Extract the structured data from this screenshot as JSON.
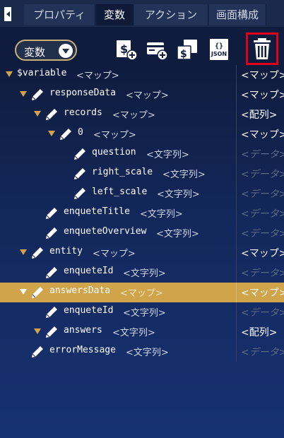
{
  "tabs": [
    {
      "label": "プロパティ",
      "active": false
    },
    {
      "label": "変数",
      "active": true
    },
    {
      "label": "アクション",
      "active": false
    },
    {
      "label": "画面構成",
      "active": false
    }
  ],
  "toolbar": {
    "dropdown_label": "変数",
    "icons": [
      "add-variable-icon",
      "add-card-icon",
      "copy-variable-icon",
      "json-icon",
      "trash-icon"
    ],
    "json_label": "JSON"
  },
  "colors": {
    "accent": "#cfa44a",
    "highlight_border": "#e0001a",
    "background": "#0f1c3e"
  },
  "tree": [
    {
      "name": "$variable",
      "type": "<マップ>",
      "value": "<マップ>",
      "depth": 0,
      "toggle": true,
      "edit": false,
      "placeholder": false,
      "selected": false
    },
    {
      "name": "responseData",
      "type": "<マップ>",
      "value": "<マップ>",
      "depth": 1,
      "toggle": true,
      "edit": true,
      "placeholder": false,
      "selected": false
    },
    {
      "name": "records",
      "type": "<マップ>",
      "value": "<配列>",
      "depth": 2,
      "toggle": true,
      "edit": true,
      "placeholder": false,
      "selected": false
    },
    {
      "name": "0",
      "type": "<マップ>",
      "value": "<マップ>",
      "depth": 3,
      "toggle": true,
      "edit": true,
      "placeholder": false,
      "selected": false
    },
    {
      "name": "question",
      "type": "<文字列>",
      "value": "<データ>",
      "depth": 4,
      "toggle": false,
      "edit": true,
      "placeholder": true,
      "selected": false
    },
    {
      "name": "right_scale",
      "type": "<文字列>",
      "value": "<データ>",
      "depth": 4,
      "toggle": false,
      "edit": true,
      "placeholder": true,
      "selected": false
    },
    {
      "name": "left_scale",
      "type": "<文字列>",
      "value": "<データ>",
      "depth": 4,
      "toggle": false,
      "edit": true,
      "placeholder": true,
      "selected": false
    },
    {
      "name": "enqueteTitle",
      "type": "<文字列>",
      "value": "<データ>",
      "depth": 2,
      "toggle": false,
      "edit": true,
      "placeholder": true,
      "selected": false
    },
    {
      "name": "enqueteOverview",
      "type": "<文字列>",
      "value": "<データ>",
      "depth": 2,
      "toggle": false,
      "edit": true,
      "placeholder": true,
      "selected": false
    },
    {
      "name": "entity",
      "type": "<マップ>",
      "value": "<マップ>",
      "depth": 1,
      "toggle": true,
      "edit": true,
      "placeholder": false,
      "selected": false
    },
    {
      "name": "enqueteId",
      "type": "<文字列>",
      "value": "<データ>",
      "depth": 2,
      "toggle": false,
      "edit": true,
      "placeholder": true,
      "selected": false
    },
    {
      "name": "answersData",
      "type": "<マップ>",
      "value": "<マップ>",
      "depth": 1,
      "toggle": true,
      "edit": true,
      "placeholder": false,
      "selected": true
    },
    {
      "name": "enqueteId",
      "type": "<文字列>",
      "value": "<データ>",
      "depth": 2,
      "toggle": false,
      "edit": true,
      "placeholder": true,
      "selected": false
    },
    {
      "name": "answers",
      "type": "<文字列>",
      "value": "<配列>",
      "depth": 2,
      "toggle": true,
      "edit": true,
      "placeholder": false,
      "selected": false
    },
    {
      "name": "errorMessage",
      "type": "<文字列>",
      "value": "<データ>",
      "depth": 1,
      "toggle": false,
      "edit": true,
      "placeholder": true,
      "selected": false
    }
  ]
}
